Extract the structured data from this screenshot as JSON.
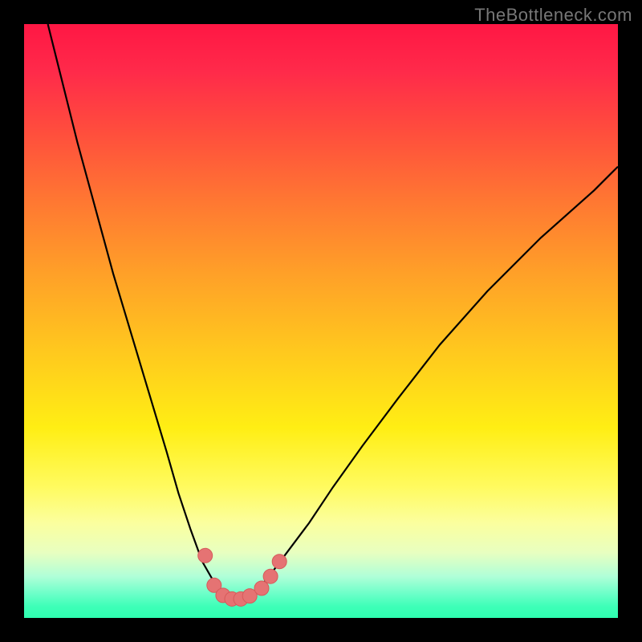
{
  "watermark": "TheBottleneck.com",
  "chart_data": {
    "type": "line",
    "title": "",
    "xlabel": "",
    "ylabel": "",
    "xlim": [
      0,
      100
    ],
    "ylim": [
      0,
      100
    ],
    "series": [
      {
        "name": "curve",
        "x": [
          4,
          6,
          9,
          12,
          15,
          18,
          21,
          24,
          26,
          28,
          30,
          32,
          33,
          34,
          35,
          36,
          37,
          38,
          40,
          42,
          45,
          48,
          52,
          57,
          63,
          70,
          78,
          87,
          96,
          100
        ],
        "values": [
          100,
          92,
          80,
          69,
          58,
          48,
          38,
          28,
          21,
          15,
          9.5,
          6,
          4.5,
          3.5,
          3,
          3,
          3.3,
          3.8,
          5.5,
          8,
          12,
          16,
          22,
          29,
          37,
          46,
          55,
          64,
          72,
          76
        ]
      }
    ],
    "markers": [
      {
        "x": 30.5,
        "y": 10.5
      },
      {
        "x": 32.0,
        "y": 5.5
      },
      {
        "x": 33.5,
        "y": 3.8
      },
      {
        "x": 35.0,
        "y": 3.2
      },
      {
        "x": 36.5,
        "y": 3.2
      },
      {
        "x": 38.0,
        "y": 3.7
      },
      {
        "x": 40.0,
        "y": 5.0
      },
      {
        "x": 41.5,
        "y": 7.0
      },
      {
        "x": 43.0,
        "y": 9.5
      }
    ],
    "colors": {
      "curve_stroke": "#000000",
      "marker_fill": "#e57373",
      "marker_stroke": "#d65a5a",
      "gradient_top": "#ff1744",
      "gradient_bottom": "#2effb0"
    }
  }
}
